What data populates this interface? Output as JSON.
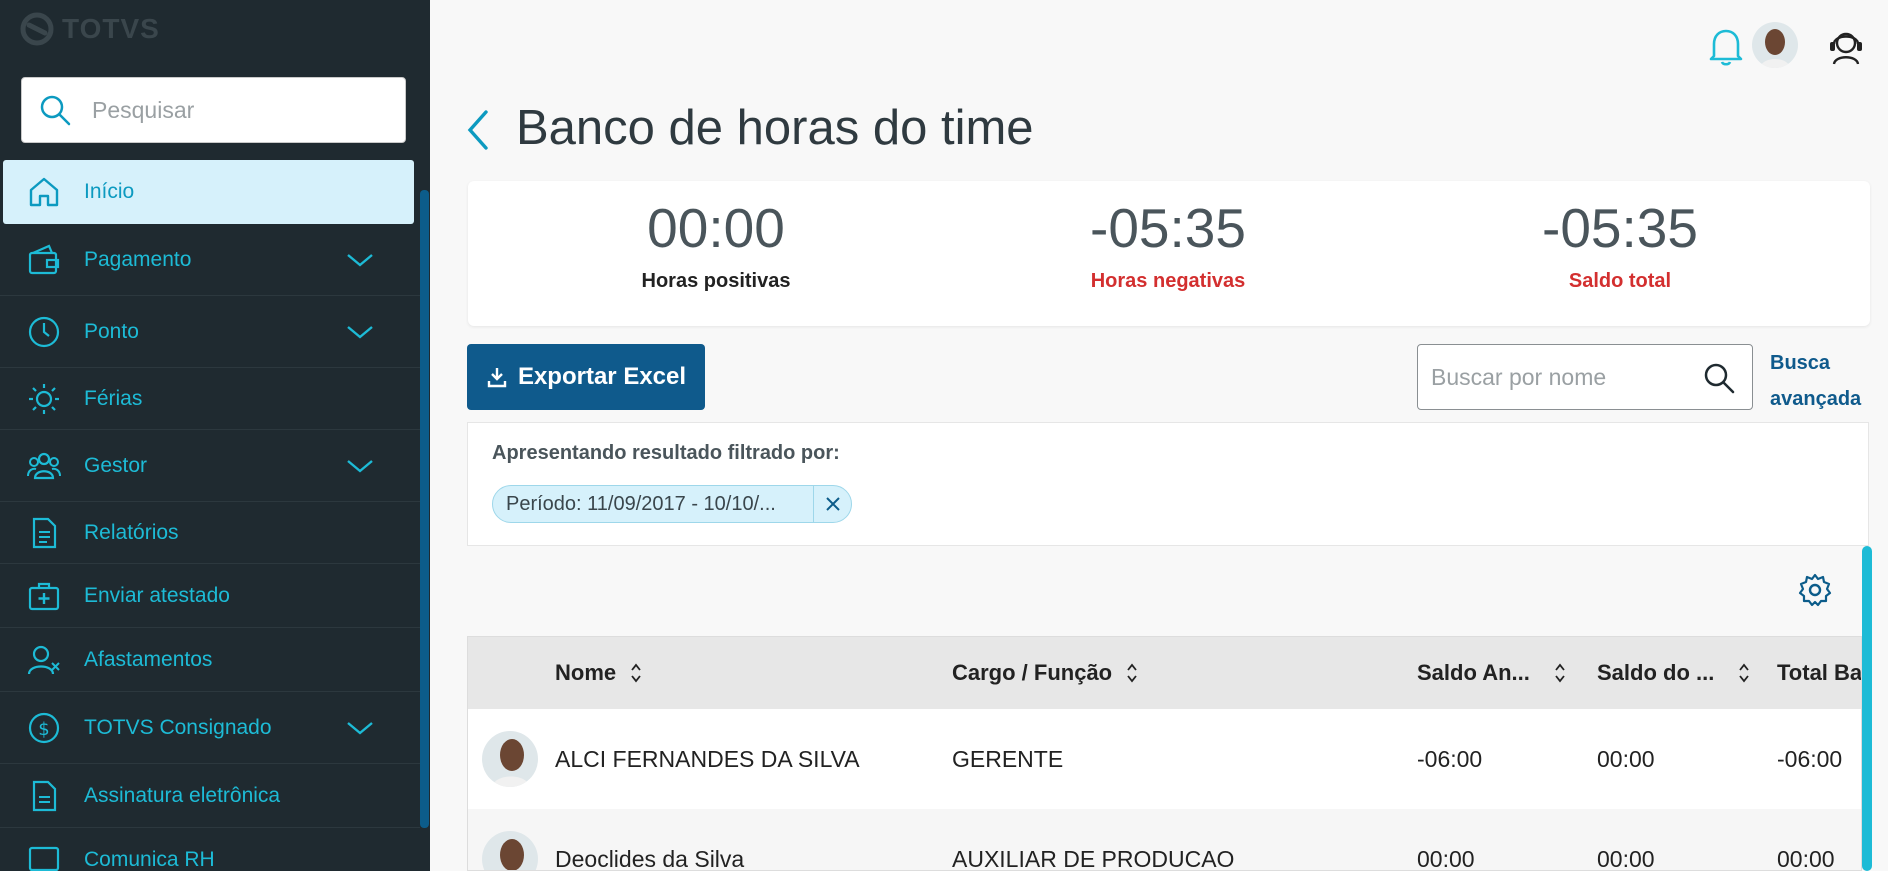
{
  "brand": {
    "name": "TOTVS"
  },
  "sidebar": {
    "search_placeholder": "Pesquisar",
    "items": [
      {
        "label": "Início",
        "icon": "home-icon",
        "active": true,
        "expandable": false
      },
      {
        "label": "Pagamento",
        "icon": "wallet-icon",
        "active": false,
        "expandable": true
      },
      {
        "label": "Ponto",
        "icon": "clock-icon",
        "active": false,
        "expandable": true
      },
      {
        "label": "Férias",
        "icon": "sun-icon",
        "active": false,
        "expandable": false
      },
      {
        "label": "Gestor",
        "icon": "users-icon",
        "active": false,
        "expandable": true
      },
      {
        "label": "Relatórios",
        "icon": "document-icon",
        "active": false,
        "expandable": false
      },
      {
        "label": "Enviar atestado",
        "icon": "medical-kit-icon",
        "active": false,
        "expandable": false
      },
      {
        "label": "Afastamentos",
        "icon": "user-remove-icon",
        "active": false,
        "expandable": false
      },
      {
        "label": "TOTVS Consignado",
        "icon": "dollar-icon",
        "active": false,
        "expandable": true
      },
      {
        "label": "Assinatura eletrônica",
        "icon": "signature-doc-icon",
        "active": false,
        "expandable": false
      },
      {
        "label": "Comunica RH",
        "icon": "message-icon",
        "active": false,
        "expandable": false
      }
    ]
  },
  "header": {
    "title": "Banco de horas do time"
  },
  "summary": {
    "positive": {
      "value": "00:00",
      "label": "Horas positivas"
    },
    "negative": {
      "value": "-05:35",
      "label": "Horas negativas"
    },
    "total": {
      "value": "-05:35",
      "label": "Saldo total"
    }
  },
  "toolbar": {
    "export_label": "Exportar Excel",
    "search_placeholder": "Buscar por nome",
    "advanced_search_line1": "Busca",
    "advanced_search_line2": "avançada"
  },
  "filter": {
    "title": "Apresentando resultado filtrado por:",
    "chip_label": "Período: 11/09/2017 - 10/10/..."
  },
  "table": {
    "columns": [
      "Nome",
      "Cargo / Função",
      "Saldo An...",
      "Saldo do ...",
      "Total Ba"
    ],
    "rows": [
      {
        "name": "ALCI FERNANDES DA SILVA",
        "role": "GERENTE",
        "prev_balance": "-06:00",
        "period_balance": "00:00",
        "total": "-06:00"
      },
      {
        "name": "Deoclides da Silva",
        "role": "AUXILIAR DE PRODUCAO",
        "prev_balance": "00:00",
        "period_balance": "00:00",
        "total": "00:00"
      }
    ]
  },
  "colors": {
    "sidebar_bg": "#1f2a30",
    "accent": "#1dbbd6",
    "primary": "#0f5a8c",
    "negative": "#d32f2f",
    "active_bg": "#d6f1fb"
  }
}
